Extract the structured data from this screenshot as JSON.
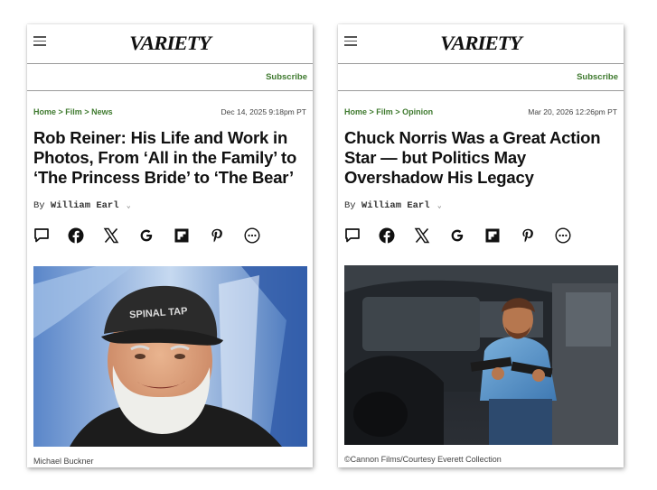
{
  "cards": [
    {
      "logo": "VARIETY",
      "subscribe": "Subscribe",
      "breadcrumb": [
        "Home",
        "Film",
        "News"
      ],
      "breadcrumb_sep": ">",
      "date": "Dec 14, 2025 9:18pm PT",
      "headline": "Rob Reiner: His Life and Work in Photos, From ‘All in the Family’ to ‘The Princess Bride’ to ‘The Bear’",
      "byline_prefix": "By",
      "author": "William Earl",
      "photo_caption": "Michael Buckner",
      "cap_text": "SPINAL TAP"
    },
    {
      "logo": "VARIETY",
      "subscribe": "Subscribe",
      "breadcrumb": [
        "Home",
        "Film",
        "Opinion"
      ],
      "breadcrumb_sep": ">",
      "date": "Mar 20, 2026 12:26pm PT",
      "headline": "Chuck Norris Was a Great Action Star — but Politics May Overshadow His Legacy",
      "byline_prefix": "By",
      "author": "William Earl",
      "photo_caption": "©Cannon Films/Courtesy Everett Collection"
    }
  ],
  "share_icons": [
    "comment-icon",
    "facebook-icon",
    "x-icon",
    "google-icon",
    "flipboard-icon",
    "pinterest-icon",
    "more-icon"
  ],
  "colors": {
    "accent_green": "#3f7a2f",
    "text": "#111111",
    "rule": "#9a9a9a"
  }
}
